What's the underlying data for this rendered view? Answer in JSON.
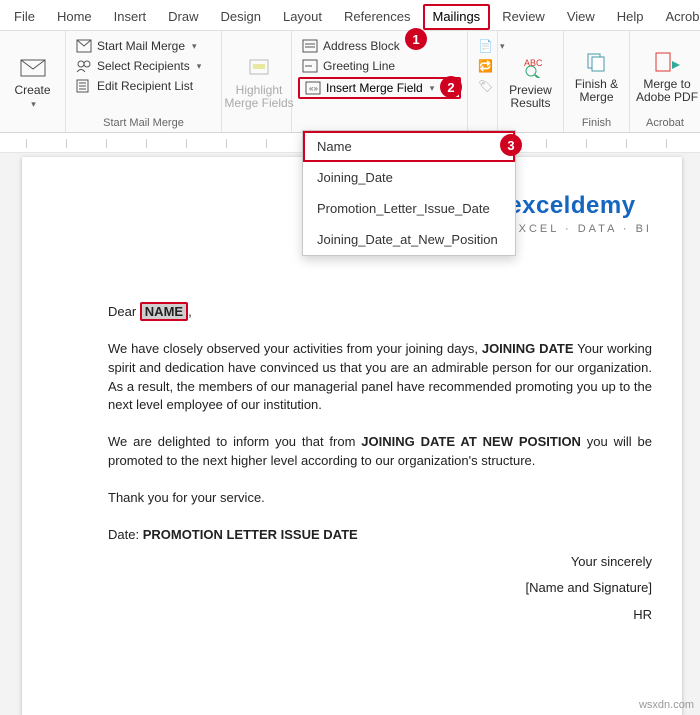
{
  "menu": {
    "tabs": [
      "File",
      "Home",
      "Insert",
      "Draw",
      "Design",
      "Layout",
      "References",
      "Mailings",
      "Review",
      "View",
      "Help",
      "Acrobat"
    ],
    "active": "Mailings"
  },
  "ribbon": {
    "create": {
      "label": "Create"
    },
    "startGroup": {
      "label": "Start Mail Merge",
      "startMailMerge": "Start Mail Merge",
      "selectRecipients": "Select Recipients",
      "editRecipientList": "Edit Recipient List"
    },
    "highlight": "Highlight\nMerge Fields",
    "writeInsert": {
      "addressBlock": "Address Block",
      "greetingLine": "Greeting Line",
      "insertMergeField": "Insert Merge Field",
      "dropdown": [
        "Name",
        "Joining_Date",
        "Promotion_Letter_Issue_Date",
        "Joining_Date_at_New_Position"
      ]
    },
    "preview": {
      "label": "Preview\nResults"
    },
    "finish": {
      "label": "Finish &\nMerge",
      "group": "Finish"
    },
    "acrobat": {
      "label": "Merge to\nAdobe PDF",
      "group": "Acrobat"
    }
  },
  "callouts": {
    "n1": "1",
    "n2": "2",
    "n3": "3"
  },
  "watermark": {
    "brand": "exceldemy",
    "tag": "EXCEL · DATA · BI"
  },
  "letter": {
    "salutation_pre": "Dear ",
    "salutation_field": "NAME",
    "p1a": "We have closely observed your activities from your joining days, ",
    "p1field": "JOINING DATE",
    "p1b": " Your working spirit and dedication have convinced us that you are an admirable person for our organization. As a result, the members of our managerial panel have recommended promoting you up to the next level employee of our institution.",
    "p2a": "We are delighted to inform you that from ",
    "p2field": "JOINING DATE AT NEW POSITION",
    "p2b": " you will be promoted to the next higher level according to our organization's structure.",
    "thanks": "Thank you for your service.",
    "date_pre": "Date: ",
    "date_field": "PROMOTION LETTER ISSUE DATE",
    "sign1": "Your sincerely",
    "sign2": "[Name and Signature]",
    "sign3": "HR"
  },
  "source": "wsxdn.com"
}
